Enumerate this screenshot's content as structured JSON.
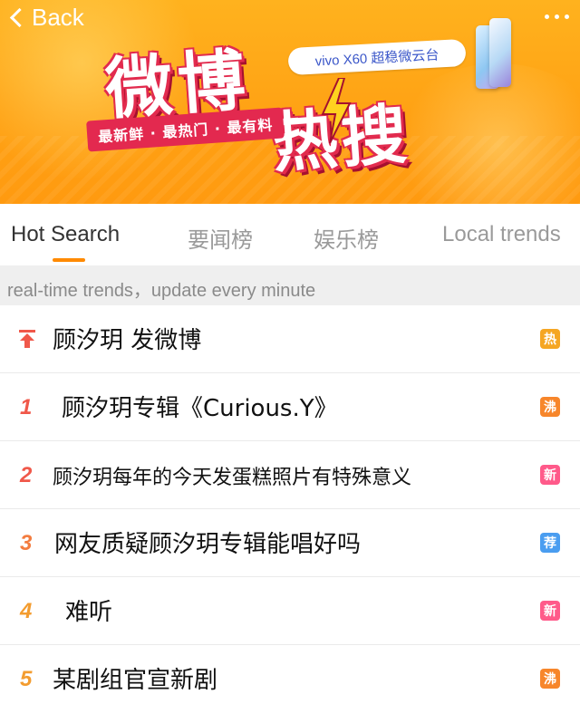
{
  "banner": {
    "back_label": "Back",
    "logo_line1": "微博",
    "logo_line2": "热搜",
    "slogan": "最新鲜 · 最热门 · 最有料",
    "sponsor": "vivo X60 超稳微云台"
  },
  "tabs": [
    {
      "label": "Hot Search",
      "active": true
    },
    {
      "label": "要闻榜",
      "active": false
    },
    {
      "label": "娱乐榜",
      "active": false
    },
    {
      "label": "Local trends",
      "active": false
    }
  ],
  "info": "real-time trends，update every minute",
  "list": [
    {
      "rank": "",
      "pinned": true,
      "title": "顾汐玥 发微博",
      "badge": "热",
      "badge_color": "#f5a623"
    },
    {
      "rank": "1",
      "title": "顾汐玥专辑《Curious.Y》",
      "badge": "沸",
      "badge_color": "#f7862b"
    },
    {
      "rank": "2",
      "title": "顾汐玥每年的今天发蛋糕照片有特殊意义",
      "badge": "新",
      "badge_color": "#ff5a8a"
    },
    {
      "rank": "3",
      "title": "网友质疑顾汐玥专辑能唱好吗",
      "badge": "荐",
      "badge_color": "#4a9df0"
    },
    {
      "rank": "4",
      "title": "难听",
      "badge": "新",
      "badge_color": "#ff5a8a"
    },
    {
      "rank": "5",
      "title": "某剧组官宣新剧",
      "badge": "沸",
      "badge_color": "#f7862b"
    }
  ],
  "colors": {
    "accent": "#ff8a00",
    "brand_red": "#e22b4e",
    "banner": "#ffa214"
  }
}
